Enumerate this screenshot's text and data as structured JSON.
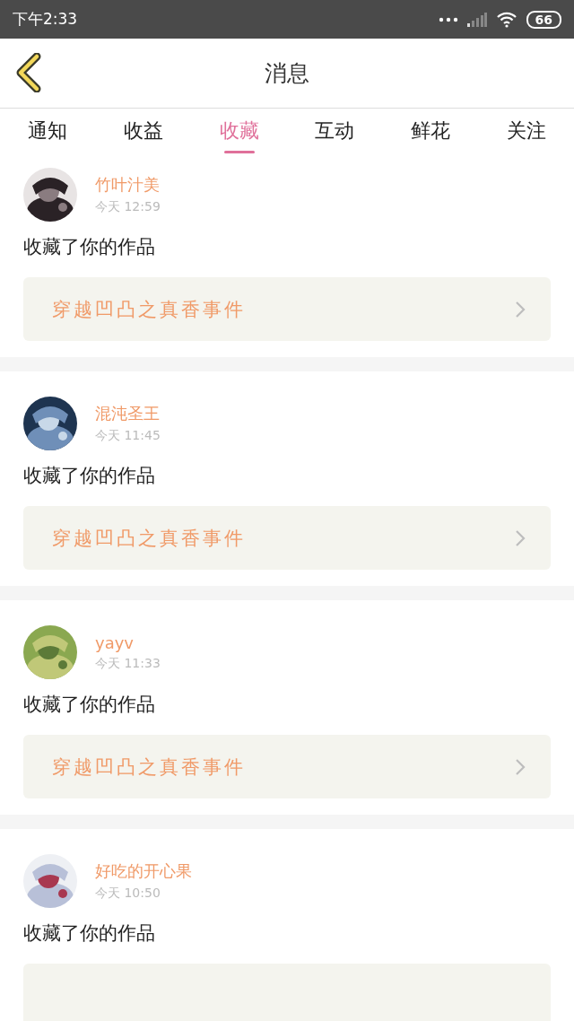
{
  "status_bar": {
    "time": "下午2:33",
    "battery": "66"
  },
  "header": {
    "title": "消息"
  },
  "tabs": [
    {
      "label": "通知",
      "selected": false
    },
    {
      "label": "收益",
      "selected": false
    },
    {
      "label": "收藏",
      "selected": true
    },
    {
      "label": "互动",
      "selected": false
    },
    {
      "label": "鲜花",
      "selected": false
    },
    {
      "label": "关注",
      "selected": false
    }
  ],
  "messages": [
    {
      "user": "竹叶汁美",
      "time": "今天 12:59",
      "action": "收藏了你的作品",
      "work": "穿越凹凸之真香事件"
    },
    {
      "user": "混沌圣王",
      "time": "今天 11:45",
      "action": "收藏了你的作品",
      "work": "穿越凹凸之真香事件"
    },
    {
      "user": "yayv",
      "time": "今天 11:33",
      "action": "收藏了你的作品",
      "work": "穿越凹凸之真香事件"
    },
    {
      "user": "好吃的开心果",
      "time": "今天 10:50",
      "action": "收藏了你的作品"
    }
  ]
}
